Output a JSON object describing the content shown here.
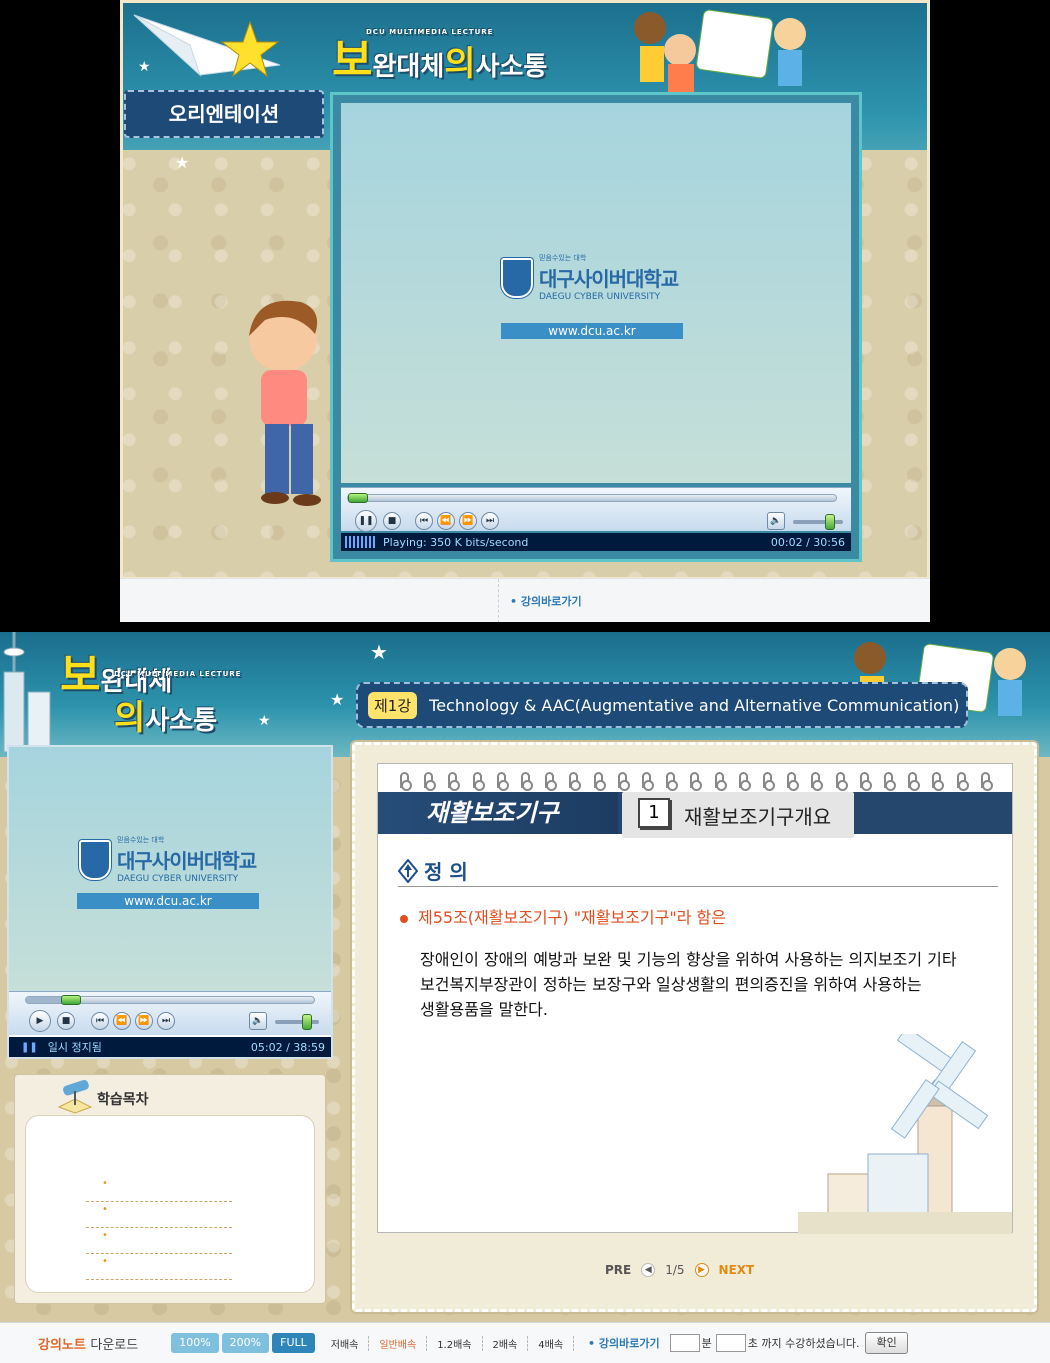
{
  "top_screen": {
    "brand_small": "DCU MULTIMEDIA LECTURE",
    "title_hl1": "보",
    "title_mid": "완대체",
    "title_hl2": "의",
    "title_end": "사소통",
    "section_label": "오리엔테이션",
    "video": {
      "logo_tagline": "믿음수있는 대학",
      "logo_name_ko": "대구사이버대학교",
      "logo_name_en": "DAEGU CYBER UNIVERSITY",
      "url": "www.dcu.ac.kr"
    },
    "player": {
      "progress": 0.001,
      "status_text": "Playing: 350 K bits/second",
      "time": "00:02 / 30:56",
      "volume": 0.8
    },
    "quick_link": "강의바로가기"
  },
  "bottom_screen": {
    "brand_small": "DCU MULTIMEDIA LECTURE",
    "title_hl1": "보",
    "title_mid": "완대체",
    "title_hl2": "의",
    "title_end": "사소통",
    "lecture_number": "제1강",
    "lecture_title": "Technology & AAC(Augmentative and Alternative Communication)",
    "video": {
      "logo_tagline": "믿음수있는 대학",
      "logo_name_ko": "대구사이버대학교",
      "logo_name_en": "DAEGU CYBER UNIVERSITY",
      "url": "www.dcu.ac.kr"
    },
    "player": {
      "progress": 0.13,
      "status_text": "일시 정지됨",
      "time": "05:02 / 38:59",
      "volume": 0.8
    },
    "toc_title": "학습목차",
    "slide": {
      "chapter": "재활보조기구",
      "item_number": "1",
      "item_title": "재활보조기구개요",
      "section_title": "정 의",
      "article": "제55조(재활보조기구) \"재활보조기구\"라 함은",
      "body": [
        "장애인이 장애의 예방과 보완 및 기능의 향상을 위하여 사용하는 의지보조기 기타",
        "보건복지부장관이 정하는 보장구와 일상생활의 편의증진을 위하여 사용하는",
        "생활용품을 말한다."
      ]
    },
    "pager": {
      "prev_label": "PRE",
      "page": "1/5",
      "next_label": "NEXT"
    },
    "bottom_bar": {
      "download_label_a": "강의노트",
      "download_label_b": "다운로드",
      "sizes": [
        "100%",
        "200%",
        "FULL"
      ],
      "speeds": [
        "저배속",
        "일반배속",
        "1.2배속",
        "2배속",
        "4배속"
      ],
      "quick_link": "강의바로가기",
      "min_label": "분",
      "sec_label": "초 까지 수강하셨습니다.",
      "confirm": "확인"
    },
    "colors": {
      "size_active": "#2e86b8",
      "size_normal": "#7fc0de",
      "speed_highlight": "#e0662a"
    }
  }
}
